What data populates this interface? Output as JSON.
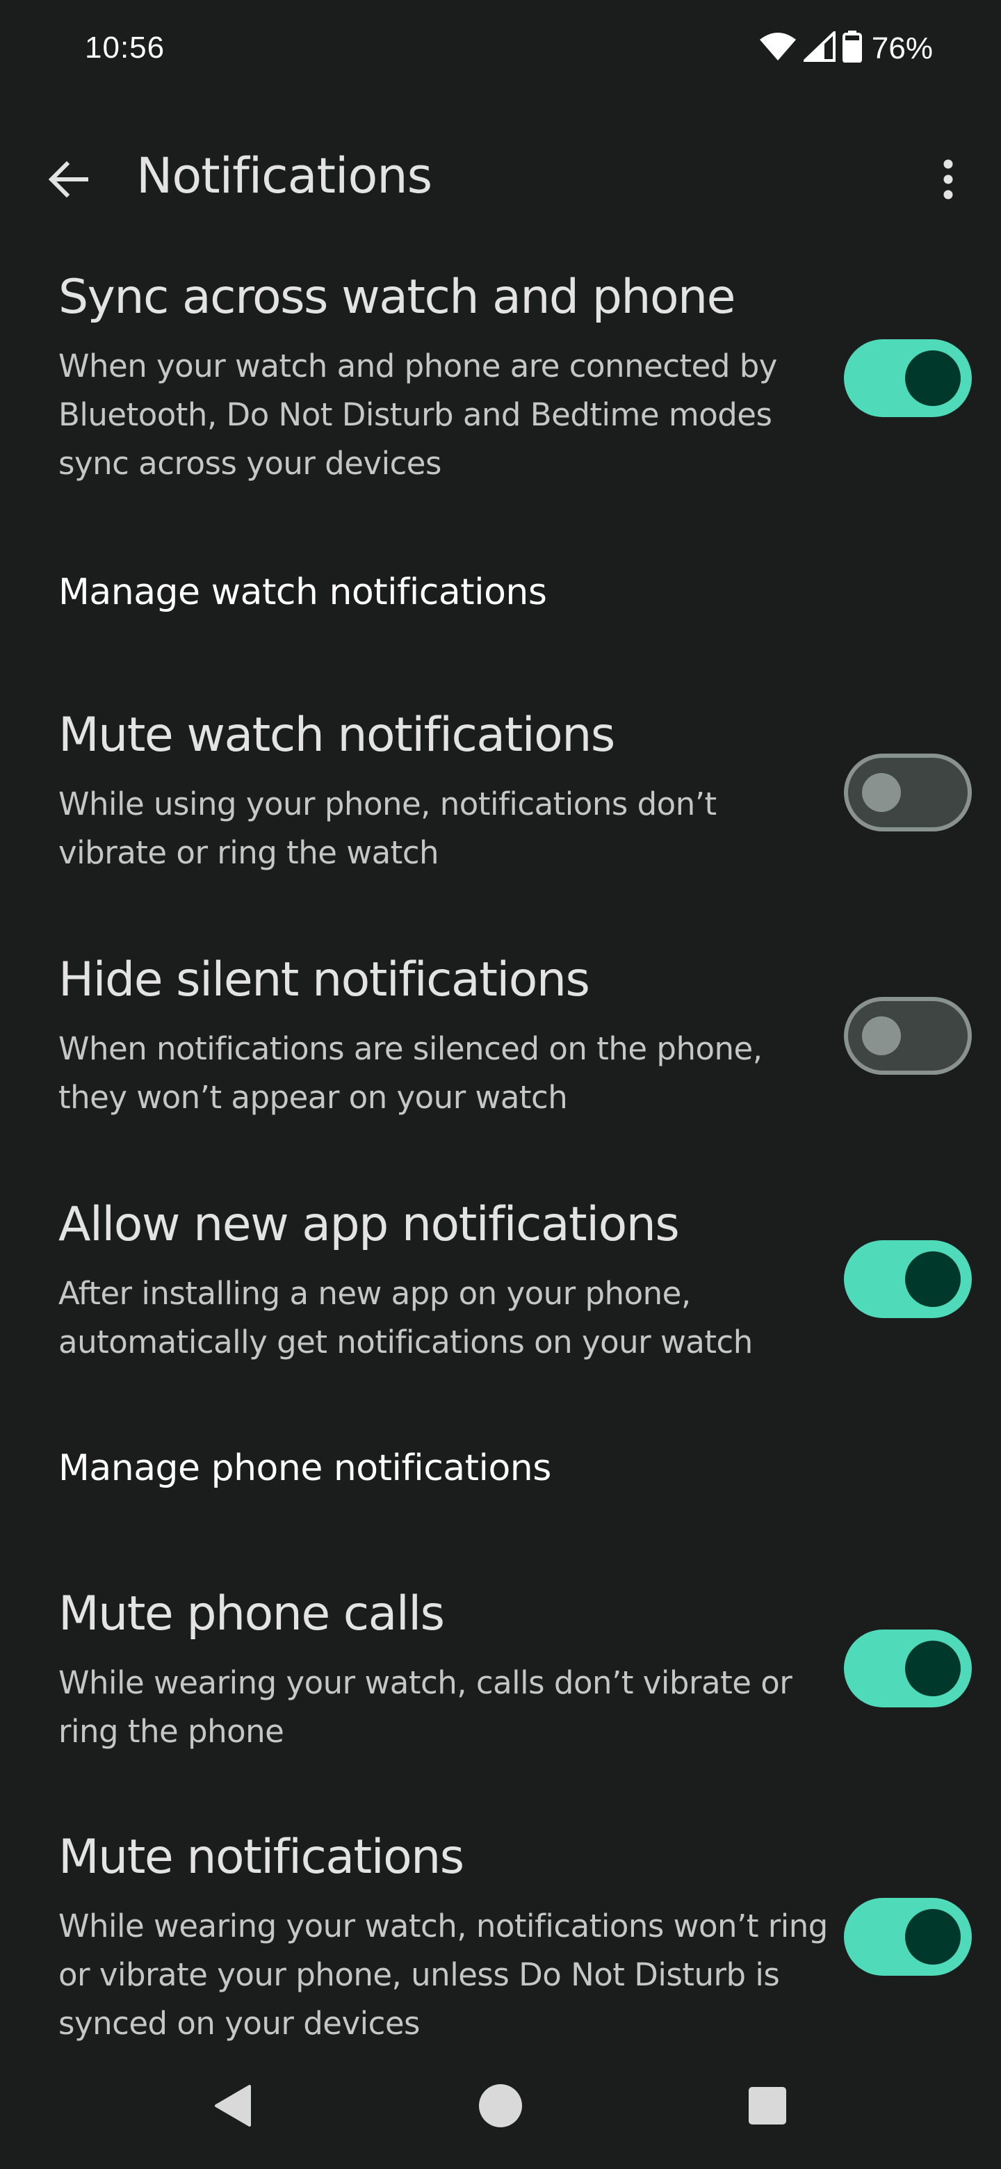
{
  "status_bar": {
    "time": "10:56",
    "battery": "76%",
    "icons": [
      "wifi-icon",
      "cellular-signal-icon",
      "battery-icon"
    ]
  },
  "app_bar": {
    "title": "Notifications",
    "back_icon": "arrow-back-icon",
    "more_icon": "more-vert-icon"
  },
  "settings": {
    "sync": {
      "title": "Sync across watch and phone",
      "summary": "When your watch and phone are connected by Bluetooth, Do Not Disturb and Bedtime modes sync across your devices",
      "enabled": true
    },
    "watch_section": "Manage watch notifications",
    "mute_watch": {
      "title": "Mute watch notifications",
      "summary": "While using your phone, notifications don’t vibrate or ring the watch",
      "enabled": false
    },
    "hide_silent": {
      "title": "Hide silent notifications",
      "summary": "When notifications are silenced on the phone, they won’t appear on your watch",
      "enabled": false
    },
    "allow_new_app": {
      "title": "Allow new app notifications",
      "summary": "After installing a new app on your phone, automatically get notifications on your watch",
      "enabled": true
    },
    "phone_section": "Manage phone notifications",
    "mute_calls": {
      "title": "Mute phone calls",
      "summary": "While wearing your watch, calls don’t vibrate or ring the phone",
      "enabled": true
    },
    "mute_notifications": {
      "title": "Mute notifications",
      "summary": "While wearing your watch, notifications won’t ring or vibrate your phone, unless Do Not Disturb is synced on your devices",
      "enabled": true
    }
  },
  "nav_bar": {
    "icons": [
      "back-triangle-icon",
      "home-circle-icon",
      "recents-square-icon"
    ]
  },
  "colors": {
    "background": "#1b1c1c",
    "switch_on_track": "#4fdbb9",
    "switch_on_thumb": "#00382c",
    "switch_off_track": "#3e4543",
    "switch_off_border": "#8a928f"
  }
}
